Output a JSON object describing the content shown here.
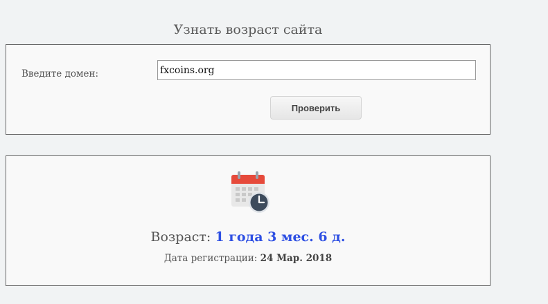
{
  "page": {
    "title": "Узнать возраст сайта"
  },
  "form": {
    "domain_label": "Введите домен:",
    "domain_value": "fxcoins.org",
    "check_button": "Проверить"
  },
  "result": {
    "icon": "calendar-clock-icon",
    "age_label": "Возраст:",
    "age_value": "1 года 3 мес. 6 д.",
    "reg_label": "Дата регистрации:",
    "reg_value": "24 Мар. 2018",
    "colors": {
      "age_value": "#2d4fe3",
      "calendar_header": "#e64a3b",
      "clock_face": "#3d4b5c"
    }
  }
}
